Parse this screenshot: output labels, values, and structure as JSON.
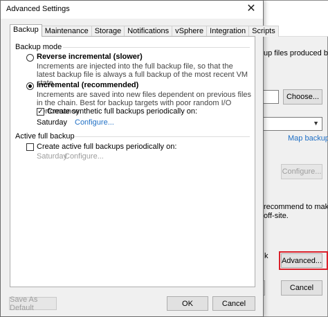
{
  "background_window": {
    "text_fragment_1": "up files produced by",
    "choose_label": "Choose...",
    "map_backup_label": "Map backup",
    "configure_label": "Configure...",
    "text_fragment_2": "recommend to make",
    "text_fragment_3": "off-site.",
    "text_fragment_4": "k",
    "advanced_label": "Advanced...",
    "cancel_label": "Cancel",
    "highlight_color": "#d9202a"
  },
  "dialog": {
    "title": "Advanced Settings",
    "tabs": [
      {
        "label": "Backup",
        "active": true
      },
      {
        "label": "Maintenance",
        "active": false
      },
      {
        "label": "Storage",
        "active": false
      },
      {
        "label": "Notifications",
        "active": false
      },
      {
        "label": "vSphere",
        "active": false
      },
      {
        "label": "Integration",
        "active": false
      },
      {
        "label": "Scripts",
        "active": false
      }
    ],
    "backup_mode": {
      "group_label": "Backup mode",
      "reverse": {
        "title": "Reverse incremental (slower)",
        "desc": "Increments are injected into the full backup file, so that the latest backup file is always a full backup of the most recent VM state.",
        "selected": false
      },
      "incremental": {
        "title": "Incremental (recommended)",
        "desc": "Increments are saved into new files dependent on previous files in the chain. Best for backup targets with poor random I/O performance.",
        "selected": true
      },
      "synthetic": {
        "label": "Create synthetic full backups periodically on:",
        "checked": true,
        "day": "Saturday",
        "configure": "Configure..."
      }
    },
    "active_full": {
      "group_label": "Active full backup",
      "label": "Create active full backups periodically on:",
      "checked": false,
      "day": "Saturday",
      "configure": "Configure..."
    },
    "buttons": {
      "save_default": "Save As Default",
      "ok": "OK",
      "cancel": "Cancel"
    }
  }
}
